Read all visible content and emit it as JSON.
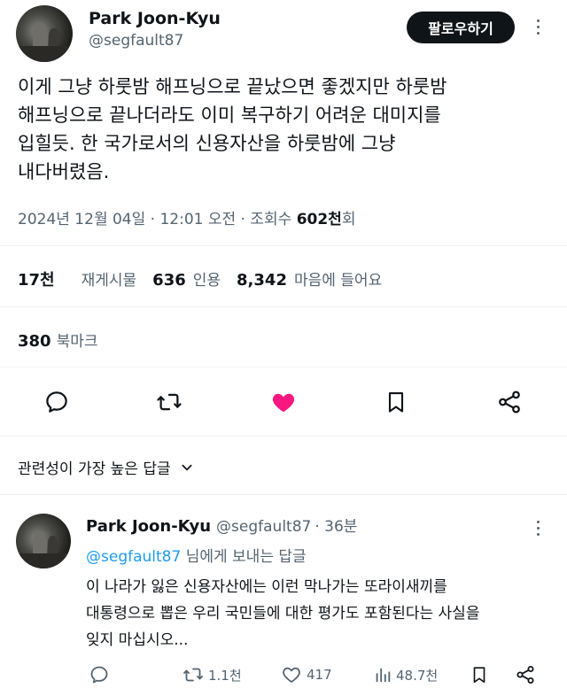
{
  "tweet": {
    "author_name": "Park Joon-Kyu",
    "author_handle": "@segfault87",
    "follow_label": "팔로우하기",
    "lines": [
      "이게 그냥 하룻밤 해프닝으로 끝났으면 좋겠지만 하룻밤",
      "해프닝으로 끝나더라도 이미 복구하기 어려운 대미지를",
      "입힐듯. 한 국가로서의 신용자산을 하룻밤에 그냥",
      "내다버렸음."
    ],
    "timestamp": "2024년 12월 04일 · 12:01 오전 · 조회수 ",
    "views": "602천",
    "views_suffix": "회"
  },
  "stats": {
    "retweets": "17천",
    "retweets_label": "재게시물",
    "quotes": "636",
    "quotes_label": "인용",
    "likes": "8,342",
    "likes_label": "마음에 들어요",
    "bookmarks": "380",
    "bookmarks_label": "북마크"
  },
  "actions": {
    "reply_icon": "reply-icon",
    "retweet_icon": "retweet-icon",
    "like_icon": "heart-filled-icon",
    "bookmark_icon": "bookmark-icon",
    "share_icon": "share-icon",
    "like_color": "#f91880"
  },
  "sort": {
    "label": "관련성이 가장 높은 답글"
  },
  "reply": {
    "author_name": "Park Joon-Kyu",
    "author_handle": "@segfault87",
    "time": "· 36분",
    "mention": "@segfault87",
    "mention_suffix": " 님에게 보내는 답글",
    "lines": [
      "이 나라가 잃은 신용자산에는 이런 막나가는 또라이새끼를",
      "대통령으로 뽑은 우리 국민들에 대한 평가도 포함된다는 사실을",
      "잊지 마십시오..."
    ],
    "retweets": "1.1천",
    "likes": "417",
    "views": "48.7천"
  }
}
